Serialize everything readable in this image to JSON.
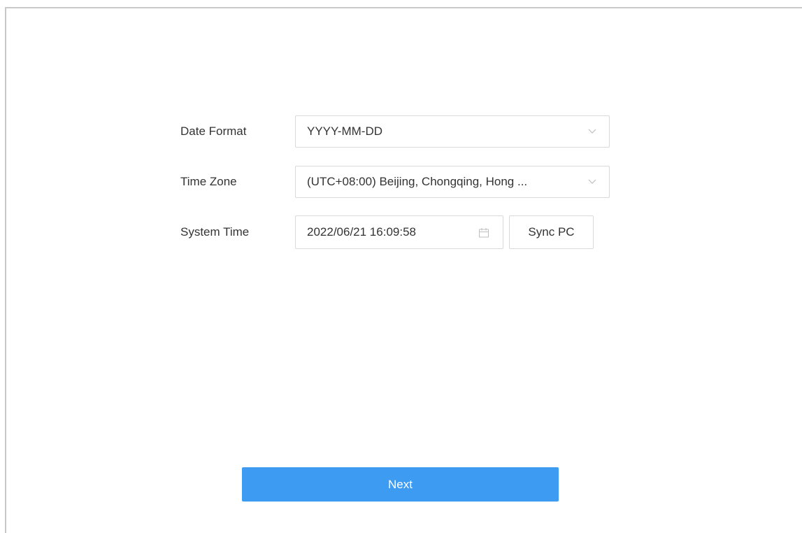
{
  "form": {
    "date_format": {
      "label": "Date Format",
      "value": "YYYY-MM-DD"
    },
    "time_zone": {
      "label": "Time Zone",
      "value": "(UTC+08:00) Beijing, Chongqing, Hong ..."
    },
    "system_time": {
      "label": "System Time",
      "value": "2022/06/21 16:09:58",
      "sync_label": "Sync PC"
    }
  },
  "actions": {
    "next_label": "Next"
  },
  "icons": {
    "dropdown": "chevron-down-icon",
    "picker": "calendar-icon"
  },
  "colors": {
    "primary": "#3d9bf2",
    "border": "#d9d9d9",
    "text": "#333333"
  }
}
